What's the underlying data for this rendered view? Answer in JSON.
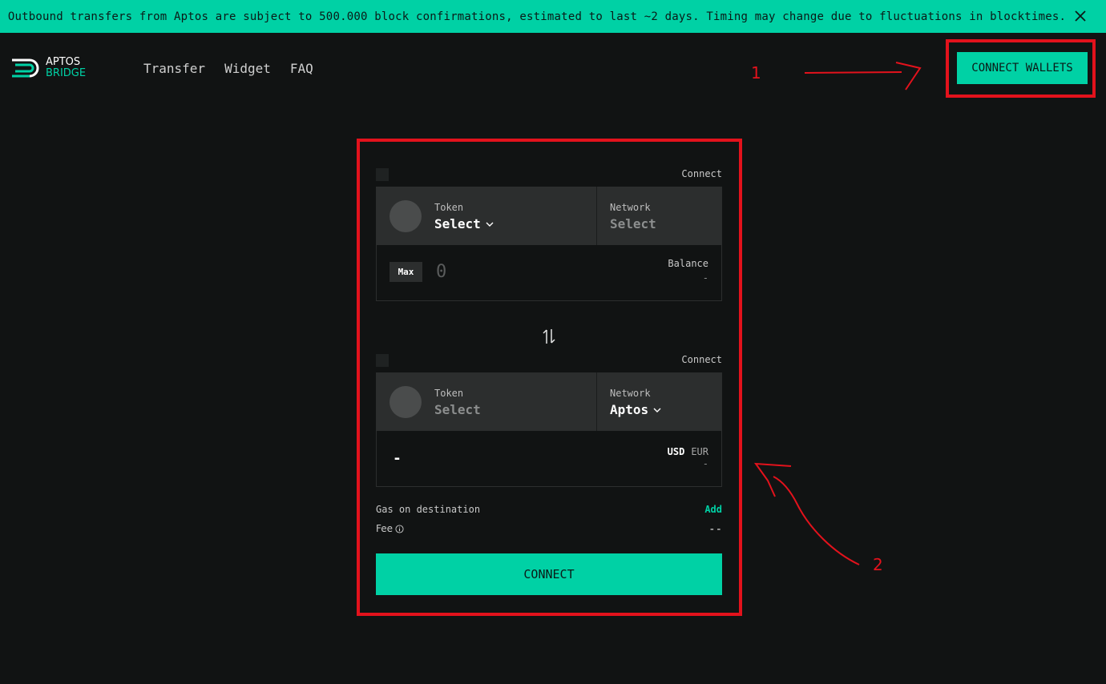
{
  "banner": {
    "text": "Outbound transfers from Aptos are subject to 500.000 block confirmations, estimated to last ~2 days. Timing may change due to fluctuations in blocktimes."
  },
  "logo": {
    "line1": "APTOS",
    "line2": "BRIDGE"
  },
  "nav": {
    "items": [
      "Transfer",
      "Widget",
      "FAQ"
    ]
  },
  "header": {
    "connect_wallets": "CONNECT WALLETS"
  },
  "source": {
    "connect": "Connect",
    "token_label": "Token",
    "token_value": "Select",
    "network_label": "Network",
    "network_value": "Select",
    "max": "Max",
    "amount_placeholder": "0",
    "balance_label": "Balance",
    "balance_value": "-"
  },
  "destination": {
    "connect": "Connect",
    "token_label": "Token",
    "token_value": "Select",
    "network_label": "Network",
    "network_value": "Aptos",
    "amount_value": "-",
    "currency_usd": "USD",
    "currency_eur": "EUR",
    "fiat_value": "-"
  },
  "details": {
    "gas_label": "Gas on destination",
    "gas_action": "Add",
    "fee_label": "Fee",
    "fee_value": "--"
  },
  "connect_button": "CONNECT",
  "annotations": {
    "marker1": "1",
    "marker2": "2"
  },
  "colors": {
    "accent": "#00d1a5",
    "background": "#111313",
    "annotation": "#e3121c"
  }
}
